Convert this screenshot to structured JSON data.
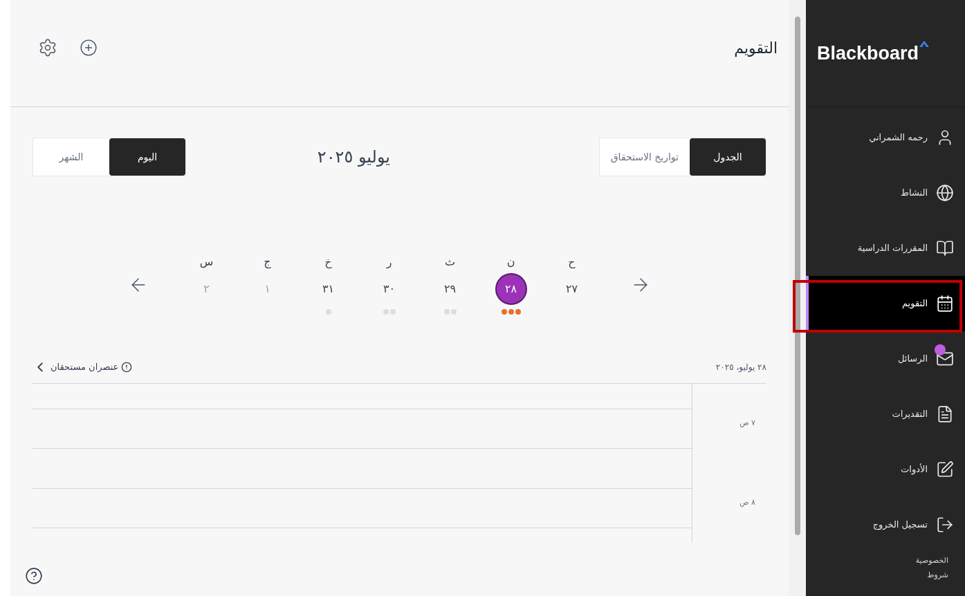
{
  "header": {
    "title": "التقويم"
  },
  "view_tabs": [
    {
      "label": "الجدول",
      "selected": true
    },
    {
      "label": "تواريخ الاستحقاق",
      "selected": false
    }
  ],
  "month_title": "يوليو ٢٠٢٥",
  "range_tabs": [
    {
      "label": "اليوم",
      "selected": true
    },
    {
      "label": "الشهر",
      "selected": false
    }
  ],
  "days": [
    {
      "label": "ح",
      "number": "٢٧",
      "selected": false,
      "muted": false
    },
    {
      "label": "ن",
      "number": "٢٨",
      "selected": true,
      "muted": false,
      "events": [
        {
          "color": "#e8702a"
        },
        {
          "color": "#e8702a"
        },
        {
          "color": "#e8702a"
        }
      ]
    },
    {
      "label": "ث",
      "number": "٢٩",
      "selected": false,
      "muted": false,
      "events": [
        {
          "color": "#dddddd"
        },
        {
          "color": "#dddddd"
        }
      ]
    },
    {
      "label": "ر",
      "number": "٣٠",
      "selected": false,
      "muted": false,
      "events": [
        {
          "color": "#dddddd"
        },
        {
          "color": "#dddddd"
        }
      ]
    },
    {
      "label": "خ",
      "number": "٣١",
      "selected": false,
      "muted": false,
      "events": [
        {
          "color": "#dddddd"
        }
      ]
    },
    {
      "label": "ج",
      "number": "١",
      "selected": false,
      "muted": true
    },
    {
      "label": "س",
      "number": "٢",
      "selected": false,
      "muted": true
    }
  ],
  "schedule": {
    "date": "٢٨ يوليو، ٢٠٢٥",
    "due_items": "عنصران مستحقان",
    "times": [
      "٧ ص",
      "٨ ص"
    ]
  },
  "sidebar": {
    "logo": "Blackboard",
    "items": [
      {
        "kind": "user",
        "label": "رحمه الشمراني",
        "selected": false,
        "badge": false
      },
      {
        "kind": "activity",
        "label": "النشاط",
        "selected": false,
        "badge": false
      },
      {
        "kind": "courses",
        "label": "المقررات الدراسية",
        "selected": false,
        "badge": false
      },
      {
        "kind": "calendar",
        "label": "التقويم",
        "selected": true,
        "badge": false
      },
      {
        "kind": "messages",
        "label": "الرسائل",
        "selected": false,
        "badge": true
      },
      {
        "kind": "grades",
        "label": "التقديرات",
        "selected": false,
        "badge": false
      },
      {
        "kind": "tools",
        "label": "الأدوات",
        "selected": false,
        "badge": false
      },
      {
        "kind": "logout",
        "label": "تسجيل الخروج",
        "selected": false,
        "badge": false
      }
    ],
    "footer": [
      "الخصوصية",
      "شروط"
    ]
  }
}
